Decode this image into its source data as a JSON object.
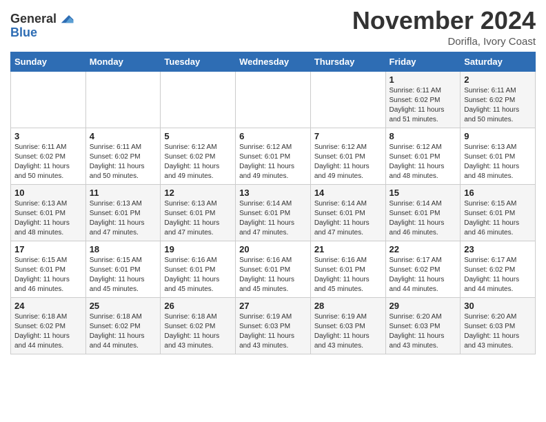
{
  "header": {
    "logo_general": "General",
    "logo_blue": "Blue",
    "month_title": "November 2024",
    "location": "Dorifla, Ivory Coast"
  },
  "days_of_week": [
    "Sunday",
    "Monday",
    "Tuesday",
    "Wednesday",
    "Thursday",
    "Friday",
    "Saturday"
  ],
  "weeks": [
    [
      {
        "day": "",
        "info": ""
      },
      {
        "day": "",
        "info": ""
      },
      {
        "day": "",
        "info": ""
      },
      {
        "day": "",
        "info": ""
      },
      {
        "day": "",
        "info": ""
      },
      {
        "day": "1",
        "info": "Sunrise: 6:11 AM\nSunset: 6:02 PM\nDaylight: 11 hours\nand 51 minutes."
      },
      {
        "day": "2",
        "info": "Sunrise: 6:11 AM\nSunset: 6:02 PM\nDaylight: 11 hours\nand 50 minutes."
      }
    ],
    [
      {
        "day": "3",
        "info": "Sunrise: 6:11 AM\nSunset: 6:02 PM\nDaylight: 11 hours\nand 50 minutes."
      },
      {
        "day": "4",
        "info": "Sunrise: 6:11 AM\nSunset: 6:02 PM\nDaylight: 11 hours\nand 50 minutes."
      },
      {
        "day": "5",
        "info": "Sunrise: 6:12 AM\nSunset: 6:02 PM\nDaylight: 11 hours\nand 49 minutes."
      },
      {
        "day": "6",
        "info": "Sunrise: 6:12 AM\nSunset: 6:01 PM\nDaylight: 11 hours\nand 49 minutes."
      },
      {
        "day": "7",
        "info": "Sunrise: 6:12 AM\nSunset: 6:01 PM\nDaylight: 11 hours\nand 49 minutes."
      },
      {
        "day": "8",
        "info": "Sunrise: 6:12 AM\nSunset: 6:01 PM\nDaylight: 11 hours\nand 48 minutes."
      },
      {
        "day": "9",
        "info": "Sunrise: 6:13 AM\nSunset: 6:01 PM\nDaylight: 11 hours\nand 48 minutes."
      }
    ],
    [
      {
        "day": "10",
        "info": "Sunrise: 6:13 AM\nSunset: 6:01 PM\nDaylight: 11 hours\nand 48 minutes."
      },
      {
        "day": "11",
        "info": "Sunrise: 6:13 AM\nSunset: 6:01 PM\nDaylight: 11 hours\nand 47 minutes."
      },
      {
        "day": "12",
        "info": "Sunrise: 6:13 AM\nSunset: 6:01 PM\nDaylight: 11 hours\nand 47 minutes."
      },
      {
        "day": "13",
        "info": "Sunrise: 6:14 AM\nSunset: 6:01 PM\nDaylight: 11 hours\nand 47 minutes."
      },
      {
        "day": "14",
        "info": "Sunrise: 6:14 AM\nSunset: 6:01 PM\nDaylight: 11 hours\nand 47 minutes."
      },
      {
        "day": "15",
        "info": "Sunrise: 6:14 AM\nSunset: 6:01 PM\nDaylight: 11 hours\nand 46 minutes."
      },
      {
        "day": "16",
        "info": "Sunrise: 6:15 AM\nSunset: 6:01 PM\nDaylight: 11 hours\nand 46 minutes."
      }
    ],
    [
      {
        "day": "17",
        "info": "Sunrise: 6:15 AM\nSunset: 6:01 PM\nDaylight: 11 hours\nand 46 minutes."
      },
      {
        "day": "18",
        "info": "Sunrise: 6:15 AM\nSunset: 6:01 PM\nDaylight: 11 hours\nand 45 minutes."
      },
      {
        "day": "19",
        "info": "Sunrise: 6:16 AM\nSunset: 6:01 PM\nDaylight: 11 hours\nand 45 minutes."
      },
      {
        "day": "20",
        "info": "Sunrise: 6:16 AM\nSunset: 6:01 PM\nDaylight: 11 hours\nand 45 minutes."
      },
      {
        "day": "21",
        "info": "Sunrise: 6:16 AM\nSunset: 6:01 PM\nDaylight: 11 hours\nand 45 minutes."
      },
      {
        "day": "22",
        "info": "Sunrise: 6:17 AM\nSunset: 6:02 PM\nDaylight: 11 hours\nand 44 minutes."
      },
      {
        "day": "23",
        "info": "Sunrise: 6:17 AM\nSunset: 6:02 PM\nDaylight: 11 hours\nand 44 minutes."
      }
    ],
    [
      {
        "day": "24",
        "info": "Sunrise: 6:18 AM\nSunset: 6:02 PM\nDaylight: 11 hours\nand 44 minutes."
      },
      {
        "day": "25",
        "info": "Sunrise: 6:18 AM\nSunset: 6:02 PM\nDaylight: 11 hours\nand 44 minutes."
      },
      {
        "day": "26",
        "info": "Sunrise: 6:18 AM\nSunset: 6:02 PM\nDaylight: 11 hours\nand 43 minutes."
      },
      {
        "day": "27",
        "info": "Sunrise: 6:19 AM\nSunset: 6:03 PM\nDaylight: 11 hours\nand 43 minutes."
      },
      {
        "day": "28",
        "info": "Sunrise: 6:19 AM\nSunset: 6:03 PM\nDaylight: 11 hours\nand 43 minutes."
      },
      {
        "day": "29",
        "info": "Sunrise: 6:20 AM\nSunset: 6:03 PM\nDaylight: 11 hours\nand 43 minutes."
      },
      {
        "day": "30",
        "info": "Sunrise: 6:20 AM\nSunset: 6:03 PM\nDaylight: 11 hours\nand 43 minutes."
      }
    ]
  ]
}
